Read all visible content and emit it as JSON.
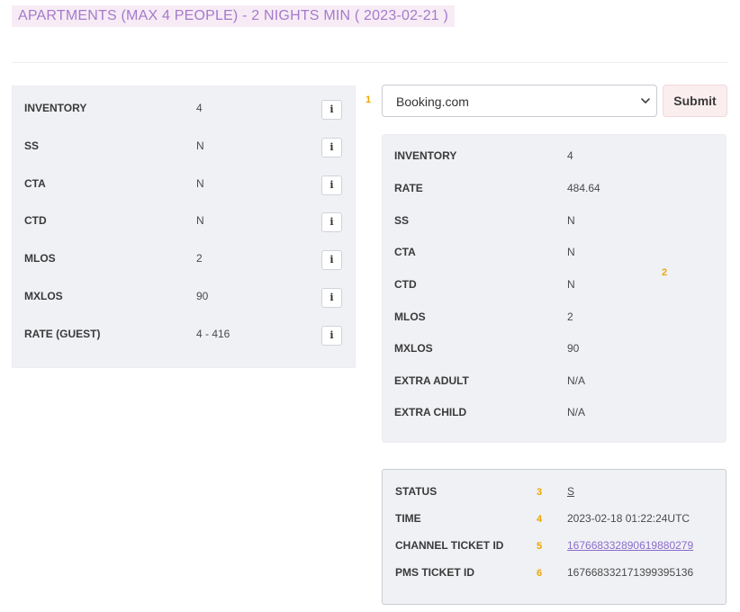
{
  "header": {
    "title": "APARTMENTS (MAX 4 PEOPLE) - 2 NIGHTS MIN ( 2023-02-21 )"
  },
  "left_panel": {
    "rows": [
      {
        "label": "INVENTORY",
        "value": "4"
      },
      {
        "label": "SS",
        "value": "N"
      },
      {
        "label": "CTA",
        "value": "N"
      },
      {
        "label": "CTD",
        "value": "N"
      },
      {
        "label": "MLOS",
        "value": "2"
      },
      {
        "label": "MXLOS",
        "value": "90"
      },
      {
        "label": "RATE (GUEST)",
        "value": "4 - 416"
      }
    ],
    "info_glyph": "i"
  },
  "markers": [
    "1",
    "2",
    "3",
    "4",
    "5",
    "6"
  ],
  "channel_select": {
    "selected": "Booking.com"
  },
  "submit_label": "Submit",
  "right_panel": {
    "rows": [
      {
        "label": "INVENTORY",
        "value": "4"
      },
      {
        "label": "RATE",
        "value": "484.64"
      },
      {
        "label": "SS",
        "value": "N"
      },
      {
        "label": "CTA",
        "value": "N"
      },
      {
        "label": "CTD",
        "value": "N"
      },
      {
        "label": "MLOS",
        "value": "2"
      },
      {
        "label": "MXLOS",
        "value": "90"
      },
      {
        "label": "EXTRA ADULT",
        "value": "N/A"
      },
      {
        "label": "EXTRA CHILD",
        "value": "N/A"
      }
    ]
  },
  "status_panel": {
    "status": {
      "label": "STATUS",
      "value": "S"
    },
    "time": {
      "label": "TIME",
      "value": "2023-02-18 01:22:24UTC"
    },
    "channel_ticket": {
      "label": "CHANNEL TICKET ID",
      "value": "167668332890619880279"
    },
    "pms_ticket": {
      "label": "PMS TICKET ID",
      "value": "167668332171399395136"
    }
  },
  "colors": {
    "title_text": "#a57acc",
    "title_background": "#f7ecf5",
    "marker": "#f0a500",
    "link": "#8a6ccb",
    "panel_background": "#f0f1f5",
    "submit_background": "#fbeeef"
  },
  "icons": {
    "info": "info-icon",
    "select_arrow": "chevron-down-icon"
  }
}
